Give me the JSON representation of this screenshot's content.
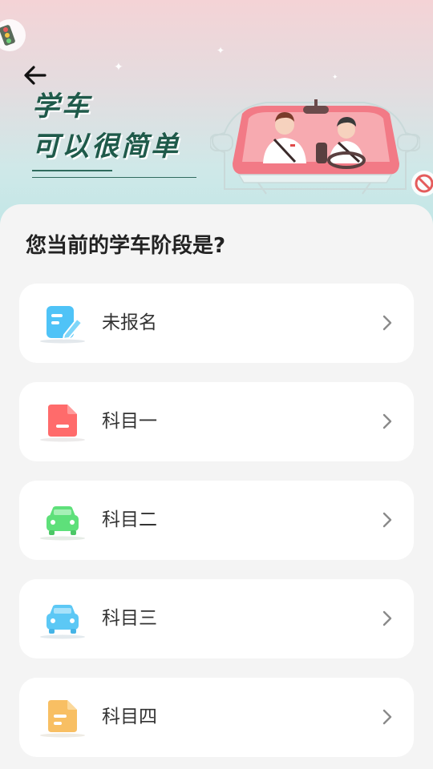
{
  "header": {
    "title_line1": "学车",
    "title_line2": "可以很简单",
    "back_icon": "arrow-left-icon"
  },
  "question": "您当前的学车阶段是?",
  "stages": [
    {
      "label": "未报名",
      "icon": "document-edit-icon",
      "color": "#4fc3f7"
    },
    {
      "label": "科目一",
      "icon": "document-icon",
      "color": "#ff6b6b"
    },
    {
      "label": "科目二",
      "icon": "car-icon",
      "color": "#5ee07a"
    },
    {
      "label": "科目三",
      "icon": "car-icon",
      "color": "#5cc8f5"
    },
    {
      "label": "科目四",
      "icon": "document-icon",
      "color": "#f8bf63"
    }
  ]
}
